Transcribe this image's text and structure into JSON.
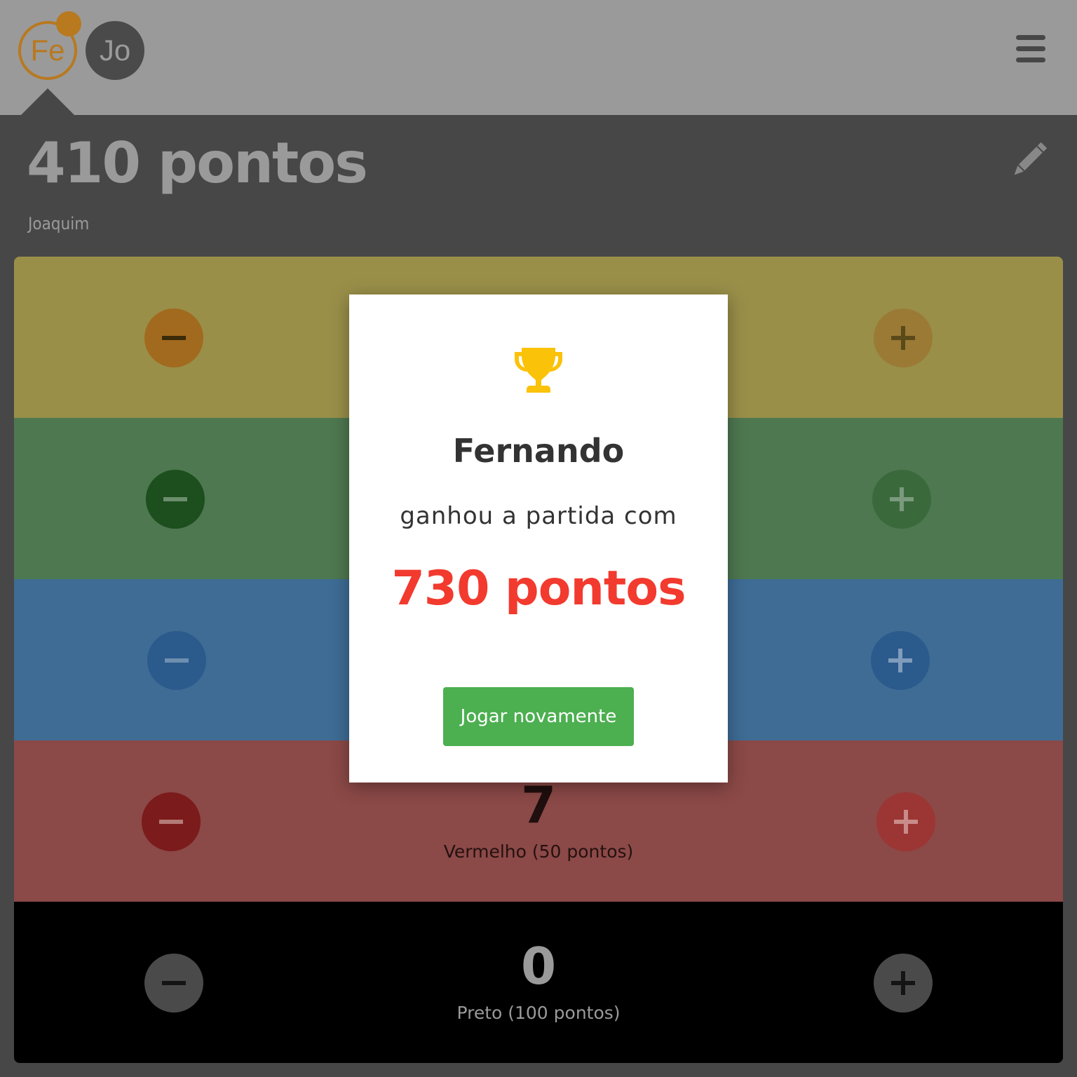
{
  "players": [
    {
      "initials": "Fe",
      "color": "#b8791f",
      "active": true
    },
    {
      "initials": "Jo",
      "color": "#4a4a4a",
      "active": false
    }
  ],
  "header": {
    "score_text": "410 pontos",
    "player_name": "Joaquim"
  },
  "icons": {
    "menu": "hamburger-menu-icon",
    "edit": "pencil-icon",
    "trophy": "trophy-icon",
    "decrement": "minus-icon",
    "increment": "plus-icon"
  },
  "rows": [
    {
      "color_name": "yellow",
      "background": "#998f49",
      "minus_color": "#a26a1e",
      "plus_color": "#9a7a34"
    },
    {
      "color_name": "green",
      "background": "#4e7850",
      "minus_color": "#1d4e1e",
      "plus_color": "#3a6a3c"
    },
    {
      "color_name": "blue",
      "background": "#3e6c95",
      "minus_color": "#2b5a8c",
      "plus_color": "#2b5a8c"
    },
    {
      "color_name": "red",
      "count": "7",
      "label": "Vermelho (50 pontos)",
      "background": "#8b4947",
      "minus_color": "#7b1b1b",
      "plus_color": "#9b3634"
    },
    {
      "color_name": "black",
      "count": "0",
      "label": "Preto (100 pontos)",
      "background": "#000000",
      "minus_color": "#4a4a4a",
      "plus_color": "#4a4a4a"
    }
  ],
  "modal": {
    "winner_name": "Fernando",
    "message": "ganhou a partida com",
    "final_score": "730 pontos",
    "play_again_label": "Jogar novamente",
    "trophy_color": "#fbc20a",
    "score_color": "#f23a2e",
    "button_color": "#4caf50"
  }
}
